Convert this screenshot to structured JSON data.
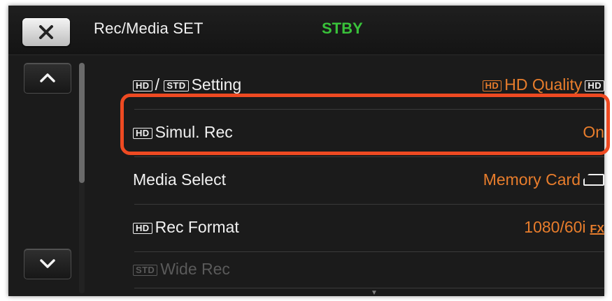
{
  "header": {
    "close_icon": "close-icon",
    "title": "Rec/Media SET",
    "status": "STBY"
  },
  "nav": {
    "up_icon": "chevron-up-icon",
    "down_icon": "chevron-down-icon"
  },
  "rows": [
    {
      "label_badges": [
        "HD",
        "STD"
      ],
      "label": "Setting",
      "label_separator": "/",
      "value_badge": "HD",
      "value": "HD Quality",
      "value_suffix_badge": "HD"
    },
    {
      "label_badge": "HD",
      "label": "Simul. Rec",
      "value": "On",
      "highlighted": true
    },
    {
      "label": "Media Select",
      "value": "Memory Card",
      "value_icon": "memory-card-icon"
    },
    {
      "label_badge": "HD",
      "label": "Rec Format",
      "value": "1080/60i",
      "value_suffix": "FX"
    },
    {
      "label_badge": "STD",
      "label": "Wide Rec",
      "disabled": true
    }
  ],
  "colors": {
    "accent": "#e87d2c",
    "status": "#39c13a",
    "highlight": "#ee4a22",
    "background": "#1b1b1b"
  }
}
